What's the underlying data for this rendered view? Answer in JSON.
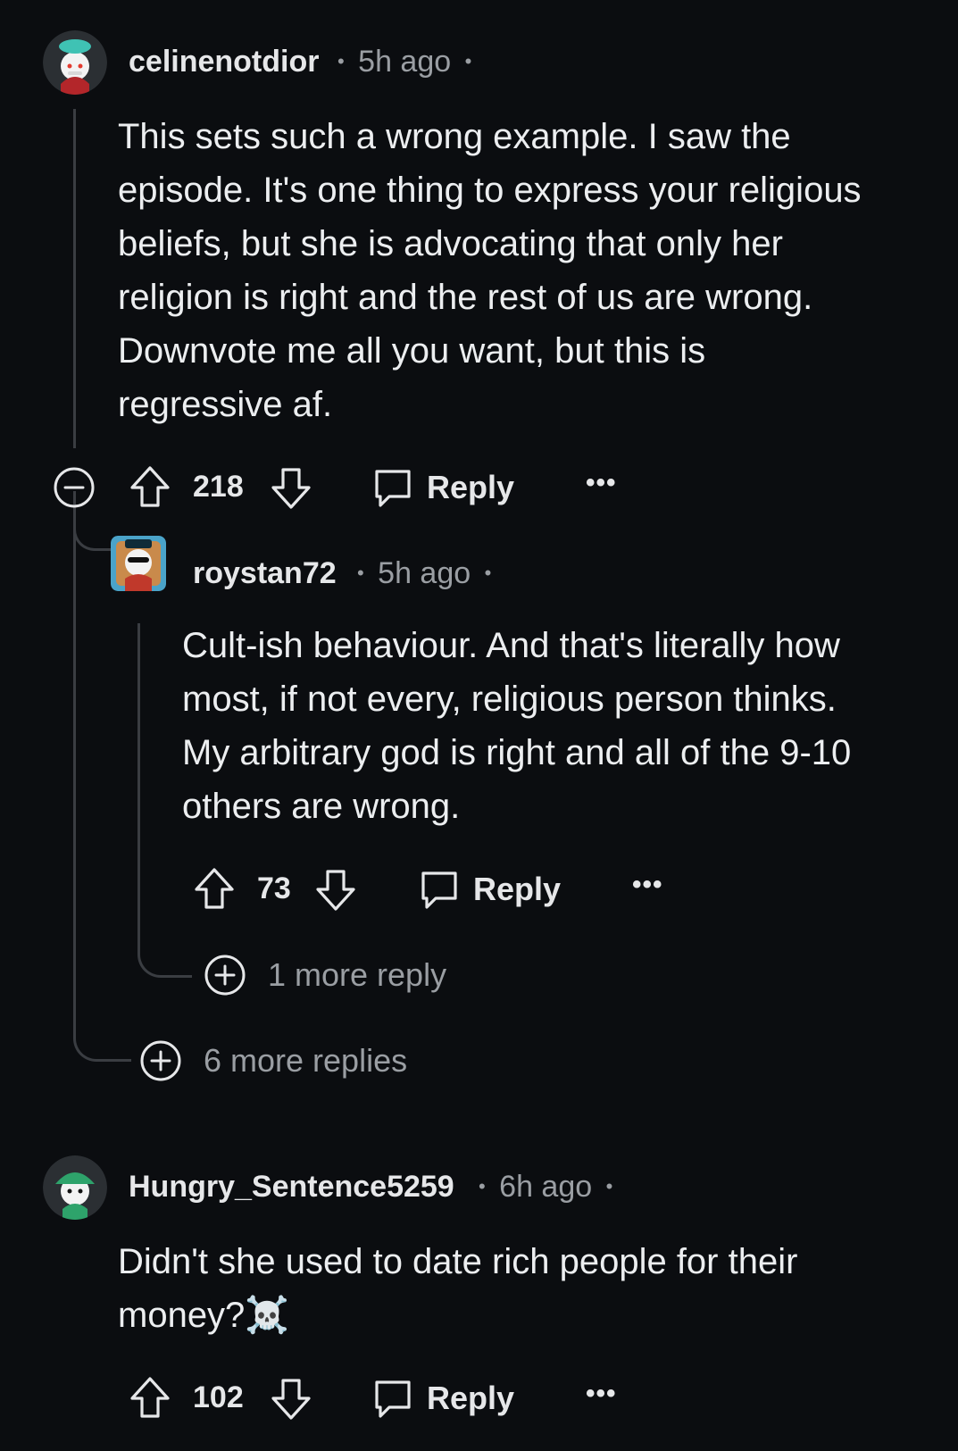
{
  "colors": {
    "background": "#0b0d10",
    "text_primary": "#eceef0",
    "text_secondary": "#9a9ea3",
    "thread_line": "#3a3d42"
  },
  "comments": [
    {
      "username": "celinenotdior",
      "time": "5h ago",
      "separator": "•",
      "body_lines": [
        "This sets such a wrong example. I saw the",
        "episode. It's one thing to express your religious",
        "beliefs, but she is advocating that only her",
        "religion is right and the rest of us are wrong.",
        "Downvote me all you want, but this is",
        "regressive af."
      ],
      "score": "218",
      "reply_label": "Reply",
      "more_icon": "more-horizontal-icon",
      "collapse_icon": "collapse-icon",
      "avatar_icon": "snoo-avatar-icon",
      "replies": [
        {
          "username": "roystan72",
          "time": "5h ago",
          "separator": "•",
          "body_lines": [
            "Cult-ish behaviour. And that's literally how",
            "most, if not every, religious person thinks.",
            "My arbitrary god is right and all of the 9-10",
            "others are wrong."
          ],
          "score": "73",
          "reply_label": "Reply",
          "avatar_icon": "snoo-avatar-icon",
          "more_replies_label": "1 more reply"
        }
      ],
      "more_replies_label": "6 more replies"
    },
    {
      "username": "Hungry_Sentence5259",
      "time": "6h ago",
      "separator": "•",
      "body_lines": [
        "Didn't she used to date rich people for their",
        "money?"
      ],
      "emoji": "☠️",
      "score": "102",
      "reply_label": "Reply",
      "avatar_icon": "snoo-avatar-icon"
    }
  ]
}
